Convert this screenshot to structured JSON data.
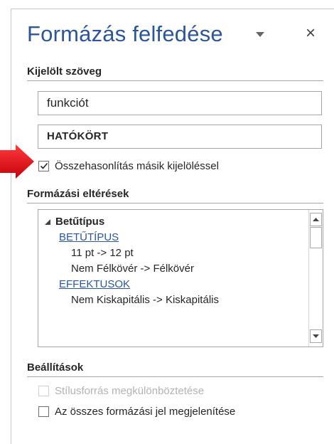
{
  "pane": {
    "title": "Formázás felfedése",
    "dropdown_icon": "caret-down-icon",
    "close_icon": "close-icon",
    "close_glyph": "×"
  },
  "selected_text": {
    "heading": "Kijelölt szöveg",
    "box1_value": "funkciót",
    "box2_value": "HATÓKÖRT",
    "compare_checkbox": {
      "label": "Összehasonlítás másik kijelöléssel",
      "checked": true
    }
  },
  "differences": {
    "heading": "Formázási eltérések",
    "group": {
      "label": "Betűtípus",
      "expanded": true,
      "items": [
        {
          "link": "BETŰTÍPUS",
          "changes": [
            "11 pt -> 12 pt",
            "Nem Félkövér -> Félkövér"
          ]
        },
        {
          "link": "EFFEKTUSOK",
          "changes": [
            "Nem Kiskapitális -> Kiskapitális"
          ]
        }
      ]
    }
  },
  "settings": {
    "heading": "Beállítások",
    "style_source": {
      "label": "Stílusforrás megkülönböztetése",
      "checked": false,
      "enabled": false
    },
    "show_marks": {
      "label": "Az összes formázási jel megjelenítése",
      "checked": false,
      "enabled": true
    }
  },
  "colors": {
    "title": "#2b579a",
    "link": "#2b579a",
    "callout_arrow": "#e0141e"
  }
}
